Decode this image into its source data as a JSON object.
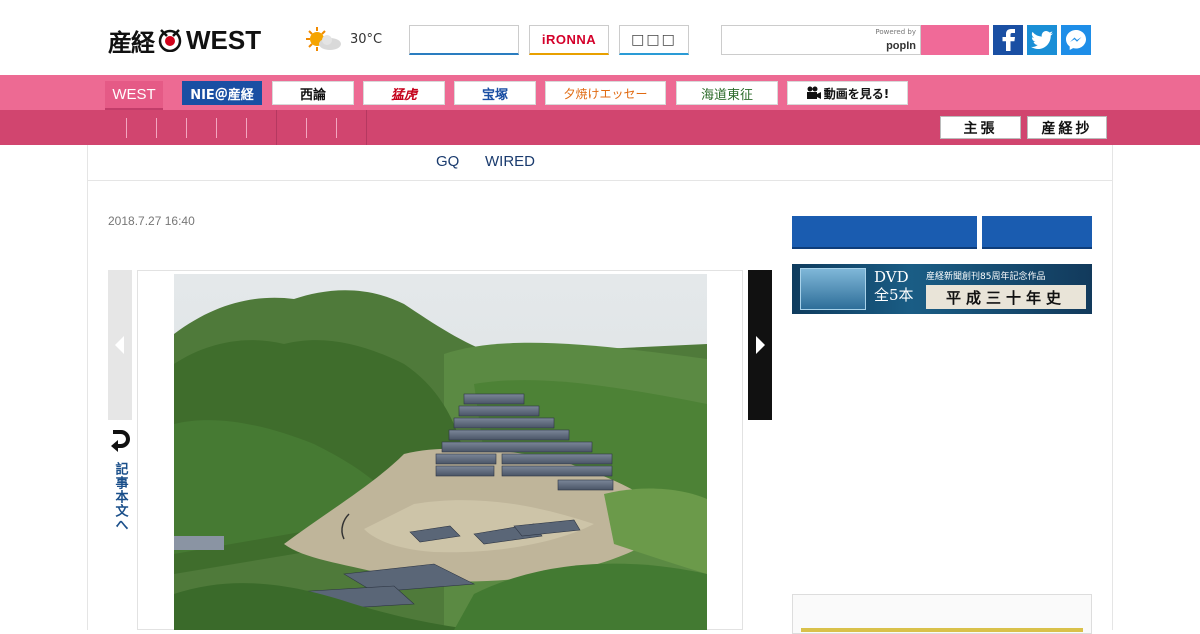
{
  "header": {
    "logo_jp": "産経",
    "logo_en": "WEST",
    "weather_temp": "30°C",
    "ironna_label": "iRONNA",
    "box3_label": "□□□",
    "search_placeholder": "",
    "popin_powered": "Powered by",
    "popin_brand": "popIn",
    "social": [
      "facebook",
      "twitter",
      "messenger"
    ]
  },
  "nav": {
    "west": "WEST",
    "items": [
      "NIE＠産経",
      "西論",
      "猛虎",
      "宝塚",
      "夕焼けエッセー",
      "海道東征",
      "動画を見る!"
    ],
    "secondary": [
      "主張",
      "産経抄"
    ]
  },
  "sublinks": [
    "GQ",
    "WIRED"
  ],
  "article": {
    "date": "2018.7.27 16:40",
    "back_label": "記事本文へ"
  },
  "sidebar": {
    "dvd_title_line1": "DVD",
    "dvd_title_line2": "全5本",
    "dvd_sub": "産経新聞創刊85周年記念作品",
    "dvd_plate": "平成三十年史"
  },
  "colors": {
    "nav_primary": "#ed6a93",
    "nav_secondary": "#d1456f",
    "link": "#1a3b6e",
    "sidebar_button": "#1a5cb0"
  }
}
